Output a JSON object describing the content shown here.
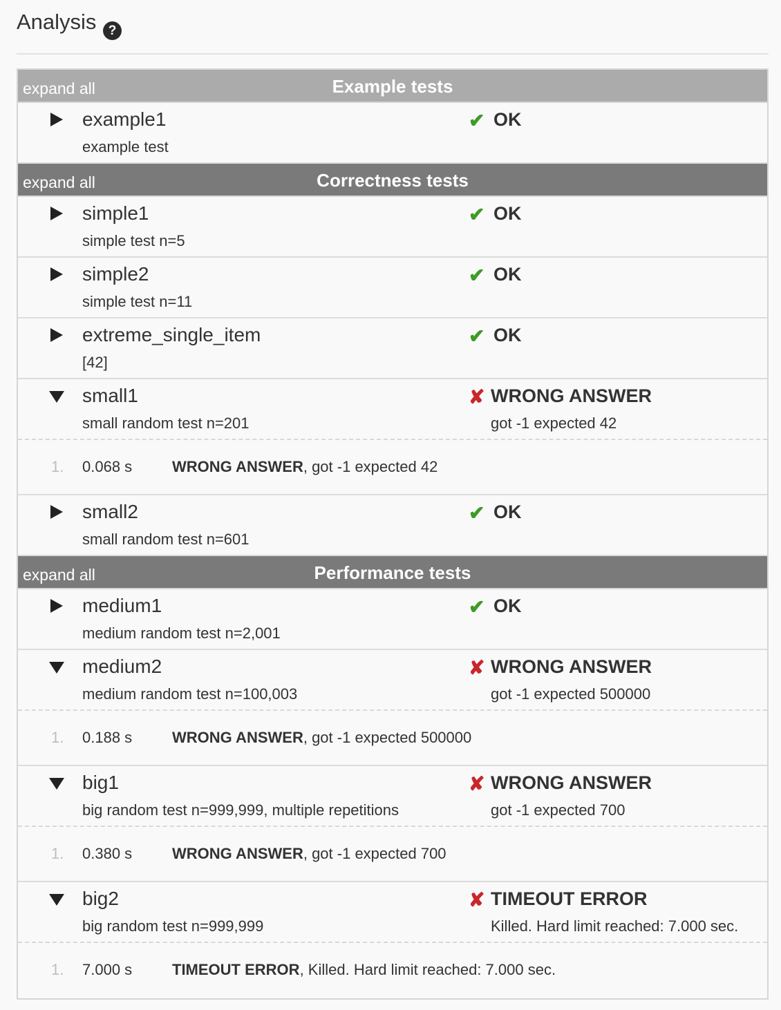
{
  "header": {
    "title": "Analysis",
    "help_icon": "question-circle-icon"
  },
  "colors": {
    "ok": "#3d9b27",
    "error": "#c9262b",
    "section_light": "#ababab",
    "section_dark": "#7a7a7a"
  },
  "sections": [
    {
      "expand_label": "expand all",
      "title": "Example tests",
      "tests": [
        {
          "name": "example1",
          "desc": "example test",
          "status": "OK",
          "ok": true,
          "expanded": false
        }
      ]
    },
    {
      "expand_label": "expand all",
      "title": "Correctness tests",
      "tests": [
        {
          "name": "simple1",
          "desc": "simple test n=5",
          "status": "OK",
          "ok": true,
          "expanded": false
        },
        {
          "name": "simple2",
          "desc": "simple test n=11",
          "status": "OK",
          "ok": true,
          "expanded": false
        },
        {
          "name": "extreme_single_item",
          "desc": "[42]",
          "status": "OK",
          "ok": true,
          "expanded": false
        },
        {
          "name": "small1",
          "desc": "small random test n=201",
          "status": "WRONG ANSWER",
          "ok": false,
          "expanded": true,
          "detail": "got -1 expected 42",
          "run": {
            "num": "1.",
            "time": "0.068 s",
            "result_bold": "WRONG ANSWER",
            "result_rest": ", got -1 expected 42"
          }
        },
        {
          "name": "small2",
          "desc": "small random test n=601",
          "status": "OK",
          "ok": true,
          "expanded": false
        }
      ]
    },
    {
      "expand_label": "expand all",
      "title": "Performance tests",
      "tests": [
        {
          "name": "medium1",
          "desc": "medium random test n=2,001",
          "status": "OK",
          "ok": true,
          "expanded": false
        },
        {
          "name": "medium2",
          "desc": "medium random test n=100,003",
          "status": "WRONG ANSWER",
          "ok": false,
          "expanded": true,
          "detail": "got -1 expected 500000",
          "run": {
            "num": "1.",
            "time": "0.188 s",
            "result_bold": "WRONG ANSWER",
            "result_rest": ", got -1 expected 500000"
          }
        },
        {
          "name": "big1",
          "desc": "big random test n=999,999, multiple repetitions",
          "status": "WRONG ANSWER",
          "ok": false,
          "expanded": true,
          "detail": "got -1 expected 700",
          "run": {
            "num": "1.",
            "time": "0.380 s",
            "result_bold": "WRONG ANSWER",
            "result_rest": ", got -1 expected 700"
          }
        },
        {
          "name": "big2",
          "desc": "big random test n=999,999",
          "status": "TIMEOUT ERROR",
          "ok": false,
          "expanded": true,
          "detail": "Killed. Hard limit reached: 7.000 sec.",
          "run": {
            "num": "1.",
            "time": "7.000 s",
            "result_bold": "TIMEOUT ERROR",
            "result_rest": ", Killed. Hard limit reached: 7.000 sec."
          }
        }
      ]
    }
  ]
}
